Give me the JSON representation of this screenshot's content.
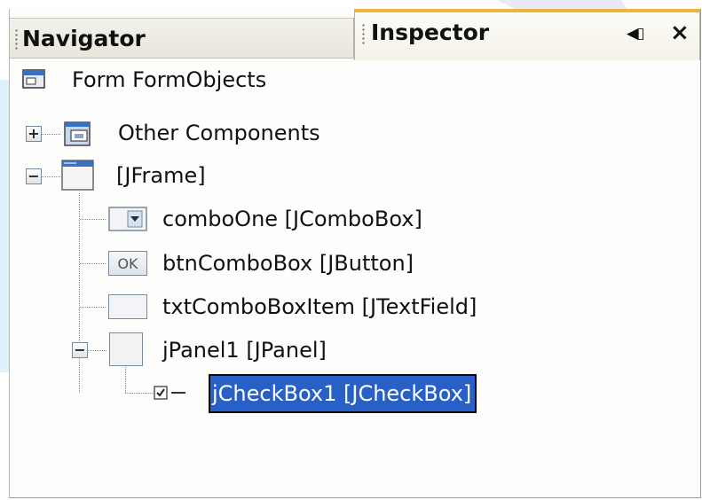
{
  "tabs": {
    "navigator": {
      "label": "Navigator"
    },
    "inspector": {
      "label": "Inspector",
      "restore_glyph": "◀▯",
      "close_glyph": "×"
    }
  },
  "tree": {
    "root": {
      "label": "Form FormObjects"
    },
    "other_components": {
      "label": "Other Components",
      "toggle": "+"
    },
    "jframe": {
      "label": "[JFrame]",
      "toggle": "−"
    },
    "combo_one": {
      "label": "comboOne [JComboBox]"
    },
    "btn_combo_box": {
      "label": "btnComboBox [JButton]",
      "icon_text": "OK"
    },
    "txt_combo_box_item": {
      "label": "txtComboBoxItem [JTextField]"
    },
    "jpanel1": {
      "label": "jPanel1 [JPanel]",
      "toggle": "−"
    },
    "jcheckbox1": {
      "label": "jCheckBox1 [JCheckBox]",
      "selected": true
    }
  },
  "colors": {
    "selection": "#2960c8",
    "active_tab_accent": "#f0b43a"
  }
}
